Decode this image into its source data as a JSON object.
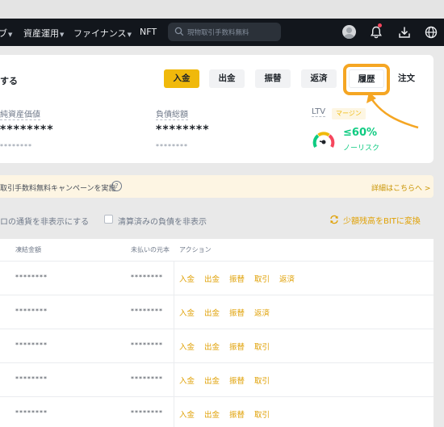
{
  "nav": {
    "items": [
      {
        "label": "ブ",
        "caret": true
      },
      {
        "label": "資産運用",
        "caret": true
      },
      {
        "label": "ファイナンス",
        "caret": true
      },
      {
        "label": "NFT",
        "caret": false
      }
    ],
    "search_placeholder": "現物取引手数料無料",
    "icons": [
      "search-icon",
      "avatar",
      "bell-icon",
      "download-icon",
      "globe-icon"
    ]
  },
  "summary": {
    "title": "する",
    "buttons": {
      "deposit": "入金",
      "withdraw": "出金",
      "transfer": "振替",
      "repay": "返済",
      "history": "履歴",
      "order": "注文"
    },
    "net_asset": {
      "label": "純資産価値",
      "value": "********",
      "sub": "********"
    },
    "total_debt": {
      "label": "負債総額",
      "value": "********",
      "sub": "********"
    },
    "ltv": {
      "label": "LTV",
      "tag": "マージン",
      "value": "≤60%",
      "risk": "ノーリスク"
    }
  },
  "banner": {
    "text": "取引手数料無料キャンペーンを実施",
    "link": "詳細はこちらへ >"
  },
  "filters": {
    "hide_zero": "ロの通貨を非表示にする",
    "hide_repaid": "清算済みの負債を非表示",
    "convert": "少額残高をBITに変換"
  },
  "table": {
    "headers": {
      "frozen": "凍結金額",
      "unpaid_principal": "未払いの元本",
      "action": "アクション"
    },
    "rows": [
      {
        "frozen": "********",
        "principal": "********",
        "actions": [
          "入金",
          "出金",
          "振替",
          "取引",
          "返済"
        ]
      },
      {
        "frozen": "********",
        "principal": "********",
        "actions": [
          "入金",
          "出金",
          "振替",
          "返済"
        ]
      },
      {
        "frozen": "********",
        "principal": "********",
        "actions": [
          "入金",
          "出金",
          "振替",
          "取引"
        ]
      },
      {
        "frozen": "********",
        "principal": "********",
        "actions": [
          "入金",
          "出金",
          "振替",
          "取引"
        ]
      },
      {
        "frozen": "********",
        "principal": "********",
        "actions": [
          "入金",
          "出金",
          "振替",
          "取引"
        ]
      }
    ]
  },
  "colors": {
    "accent": "#f0b90b",
    "link": "#e0a106",
    "positive": "#0ecb81",
    "nav_bg": "#12161c",
    "highlight": "#f5a623"
  }
}
